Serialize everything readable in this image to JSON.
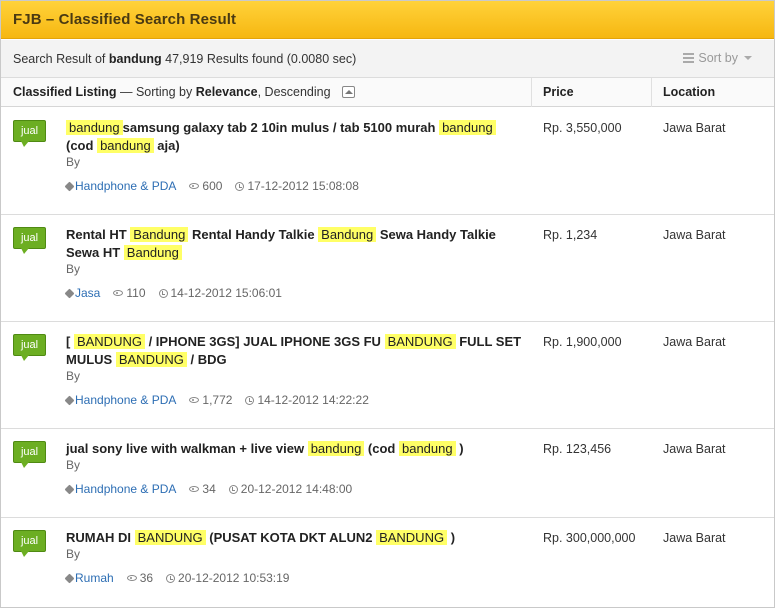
{
  "header": {
    "title": "FJB – Classified Search Result"
  },
  "summary": {
    "prefix": "Search Result of",
    "query": "bandung",
    "count_text": "47,919 Results found (0.0080 sec)"
  },
  "sort": {
    "label": "Sort by"
  },
  "columns": {
    "listing": "Classified Listing",
    "sorting_prefix": "— Sorting by",
    "sorting_by": "Relevance",
    "sorting_dir": ", Descending",
    "price": "Price",
    "location": "Location"
  },
  "listings": [
    {
      "badge": "jual",
      "title_parts": [
        {
          "t": "bandung",
          "hl": true
        },
        {
          "t": "samsung galaxy tab 2 10in mulus / tab 5100 murah ",
          "hl": false
        },
        {
          "t": "bandung",
          "hl": true
        },
        {
          "t": " (cod ",
          "hl": false
        },
        {
          "t": "bandung",
          "hl": true
        },
        {
          "t": " aja)",
          "hl": false
        }
      ],
      "by": "By",
      "category": "Handphone & PDA",
      "views": "600",
      "date": "17-12-2012 15:08:08",
      "price": "Rp. 3,550,000",
      "location": "Jawa Barat"
    },
    {
      "badge": "jual",
      "title_parts": [
        {
          "t": "Rental HT ",
          "hl": false
        },
        {
          "t": "Bandung",
          "hl": true
        },
        {
          "t": " Rental Handy Talkie ",
          "hl": false
        },
        {
          "t": "Bandung",
          "hl": true
        },
        {
          "t": " Sewa Handy Talkie Sewa HT ",
          "hl": false
        },
        {
          "t": "Bandung",
          "hl": true
        }
      ],
      "by": "By",
      "category": "Jasa",
      "views": "110",
      "date": "14-12-2012 15:06:01",
      "price": "Rp. 1,234",
      "location": "Jawa Barat"
    },
    {
      "badge": "jual",
      "title_parts": [
        {
          "t": "[ ",
          "hl": false
        },
        {
          "t": "BANDUNG",
          "hl": true
        },
        {
          "t": " / IPHONE 3GS] JUAL IPHONE 3GS FU ",
          "hl": false
        },
        {
          "t": "BANDUNG",
          "hl": true
        },
        {
          "t": " FULL SET MULUS ",
          "hl": false
        },
        {
          "t": "BANDUNG",
          "hl": true
        },
        {
          "t": " / BDG",
          "hl": false
        }
      ],
      "by": "By",
      "category": "Handphone & PDA",
      "views": "1,772",
      "date": "14-12-2012 14:22:22",
      "price": "Rp. 1,900,000",
      "location": "Jawa Barat"
    },
    {
      "badge": "jual",
      "title_parts": [
        {
          "t": "jual sony live with walkman + live view ",
          "hl": false
        },
        {
          "t": "bandung",
          "hl": true
        },
        {
          "t": " (cod ",
          "hl": false
        },
        {
          "t": "bandung",
          "hl": true
        },
        {
          "t": " )",
          "hl": false
        }
      ],
      "by": "By",
      "category": "Handphone & PDA",
      "views": "34",
      "date": "20-12-2012 14:48:00",
      "price": "Rp. 123,456",
      "location": "Jawa Barat"
    },
    {
      "badge": "jual",
      "title_parts": [
        {
          "t": "RUMAH DI ",
          "hl": false
        },
        {
          "t": "BANDUNG",
          "hl": true
        },
        {
          "t": " (PUSAT KOTA DKT ALUN2 ",
          "hl": false
        },
        {
          "t": "BANDUNG",
          "hl": true
        },
        {
          "t": " )",
          "hl": false
        }
      ],
      "by": "By",
      "category": "Rumah",
      "views": "36",
      "date": "20-12-2012 10:53:19",
      "price": "Rp. 300,000,000",
      "location": "Jawa Barat"
    }
  ]
}
